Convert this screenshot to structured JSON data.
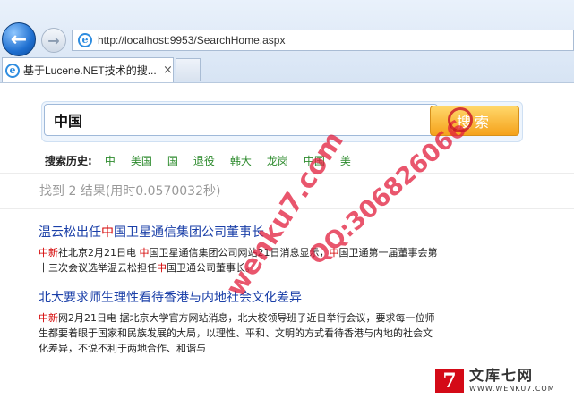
{
  "browser": {
    "url": "http://localhost:9953/SearchHome.aspx",
    "tab_title": "基于Lucene.NET技术的搜...",
    "tab_close": "×"
  },
  "search": {
    "query": "中国",
    "button_label": "搜索"
  },
  "history": {
    "label": "搜索历史:",
    "items": [
      "中",
      "美国",
      "国",
      "退役",
      "韩大",
      "龙岗",
      "中国",
      "美"
    ]
  },
  "summary": {
    "text": "找到 2 结果(用时0.0570032秒)"
  },
  "results": [
    {
      "title_parts": [
        "温云松出任",
        "中",
        "国卫星通信集团公司董事长"
      ],
      "snippet_parts": [
        "中新",
        "社北京2月21日电 ",
        "中",
        "国卫星通信集团公司网站21日消息显示，",
        "中",
        "国卫通第一届董事会第十三次会议选举温云松担任",
        "中",
        "国卫通公司董事长。"
      ]
    },
    {
      "title": "北大要求师生理性看待香港与内地社会文化差异",
      "snippet_parts": [
        "中新",
        "网2月21日电 据北京大学官方网站消息，北大校领导班子近日举行会议，要求每一位师生都要着眼于国家和民族发展的大局，以理性、平和、文明的方式看待香港与内地的社会文化差异，不说不利于两地合作、和谐与"
      ]
    }
  ],
  "watermark": {
    "text_1": "wenku7.com",
    "text_2": "QQ:306826066",
    "brand_mark": "7",
    "brand_cn": "文库七网",
    "brand_url": "WWW.WENKU7.COM",
    "color": "#e11e3c"
  },
  "colors": {
    "title_link": "#1a3fa8",
    "highlight": "#d40000",
    "history_link": "#2e8b2e",
    "search_button": "#f5a21b"
  },
  "icons": [
    "back-arrow-icon",
    "forward-arrow-icon",
    "ie-icon",
    "close-icon"
  ]
}
